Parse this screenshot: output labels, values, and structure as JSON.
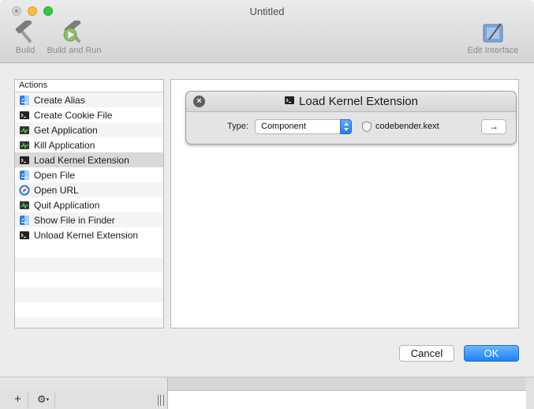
{
  "window": {
    "title": "Untitled"
  },
  "toolbar": {
    "build_label": "Build",
    "build_run_label": "Build and Run",
    "edit_interface_label": "Edit Interface"
  },
  "actions": {
    "header": "Actions",
    "items": [
      {
        "label": "Create Alias",
        "icon": "finder-icon"
      },
      {
        "label": "Create Cookie File",
        "icon": "terminal-icon"
      },
      {
        "label": "Get Application",
        "icon": "activity-monitor-icon"
      },
      {
        "label": "Kill Application",
        "icon": "activity-monitor-icon"
      },
      {
        "label": "Load Kernel Extension",
        "icon": "terminal-icon",
        "selected": true
      },
      {
        "label": "Open File",
        "icon": "finder-icon"
      },
      {
        "label": "Open URL",
        "icon": "safari-icon"
      },
      {
        "label": "Quit Application",
        "icon": "activity-monitor-icon"
      },
      {
        "label": "Show File in Finder",
        "icon": "finder-icon"
      },
      {
        "label": "Unload Kernel Extension",
        "icon": "terminal-icon"
      }
    ]
  },
  "action_card": {
    "title": "Load Kernel Extension",
    "type_label": "Type:",
    "type_value": "Component",
    "kext_name": "codebender.kext",
    "arrow_label": "→"
  },
  "buttons": {
    "cancel": "Cancel",
    "ok": "OK"
  },
  "bottom": {
    "plus": "+",
    "gear": "⚙"
  },
  "colors": {
    "accent": "#1a82fb",
    "selection": "#d9d9d9"
  }
}
